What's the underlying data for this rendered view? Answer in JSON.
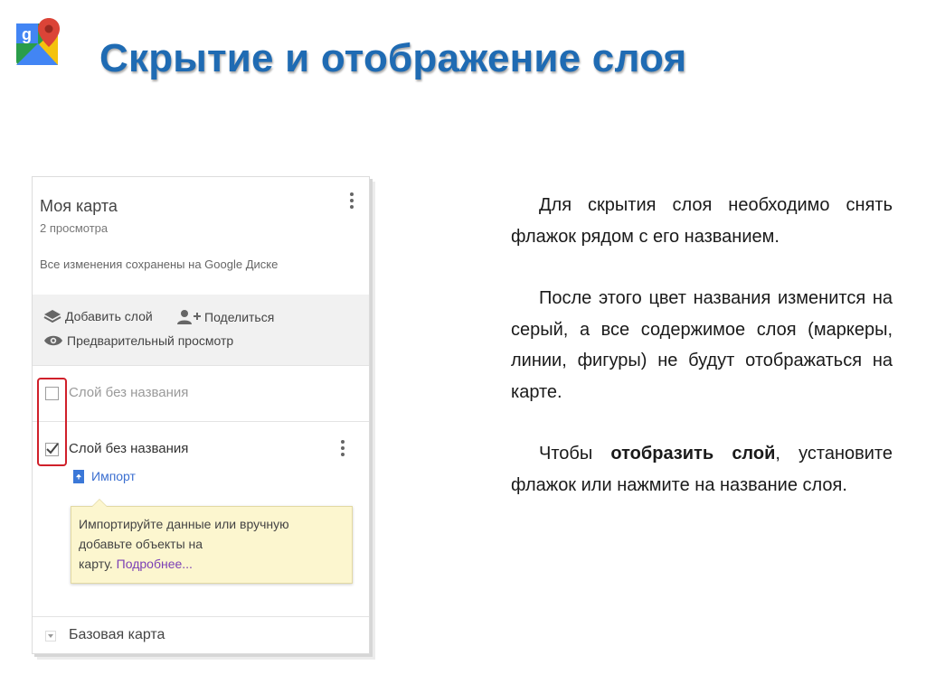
{
  "slide": {
    "title": "Скрытие и отображение слоя",
    "logo_icon": "google-my-maps-icon"
  },
  "map_panel": {
    "map_title": "Моя карта",
    "views": "2 просмотра",
    "saved_status": "Все изменения сохранены на Google Диске",
    "actions": {
      "add_layer": "Добавить слой",
      "share": "Поделиться",
      "preview": "Предварительный просмотр"
    },
    "layers": [
      {
        "name": "Слой без названия",
        "checked": false,
        "name_color": "#9a9a9a"
      },
      {
        "name": "Слой без названия",
        "checked": true,
        "name_color": "#333333"
      }
    ],
    "import_label": "Импорт",
    "tip": {
      "line1": "Импортируйте данные или вручную",
      "line2": "добавьте объекты на",
      "line3_prefix": "карту.",
      "more": "Подробнее..."
    },
    "basemap_label": "Базовая карта"
  },
  "text": {
    "p1": "Для скрытия слоя необходимо снять флажок рядом с его названием.",
    "p2": "После этого цвет названия изменится на серый, а все содержимое слоя (маркеры, линии, фигуры) не будут отображаться на карте.",
    "p3_pre": "Чтобы",
    "p3_bold": "отобразить слой",
    "p3_post": ", установите флажок или нажмите на название слоя."
  },
  "colors": {
    "title": "#1f6bb3",
    "highlight_box": "#d0202a",
    "tip_bg": "#fcf6cf",
    "link": "#3b6fd0"
  }
}
